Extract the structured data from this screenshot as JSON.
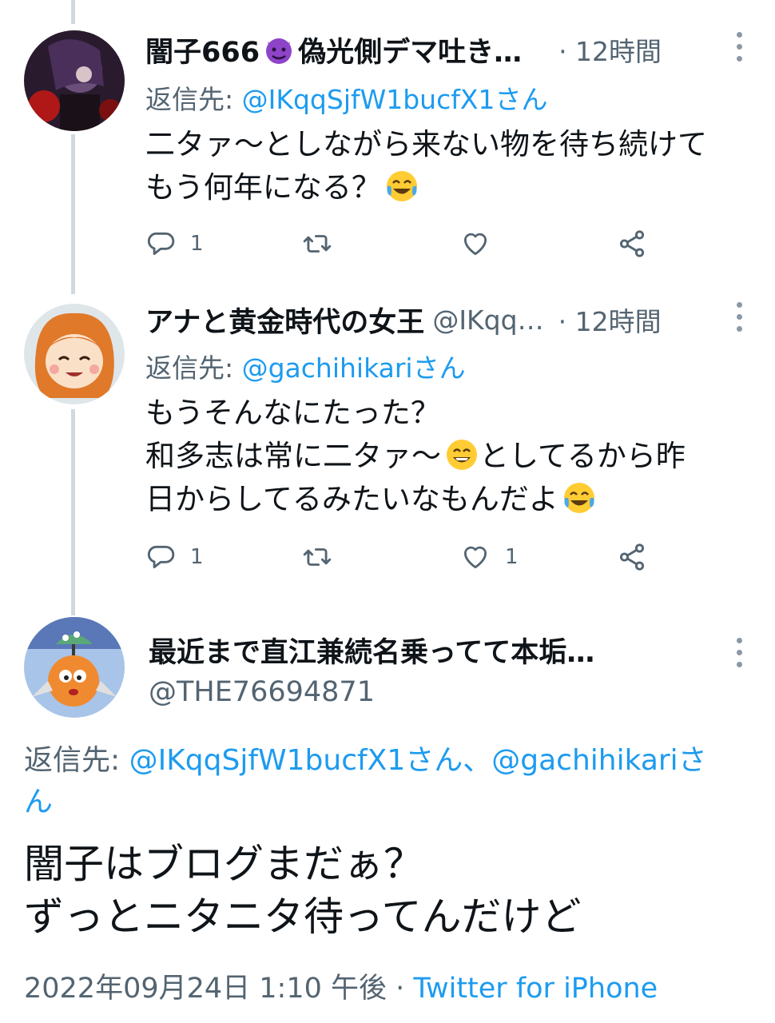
{
  "tweets": [
    {
      "display_name": "闇子666",
      "display_name_emoji": "devil-emoji",
      "display_name_rest": "偽光側デマ吐き…",
      "handle": "",
      "time": "· 12時間",
      "reply_label": "返信先: ",
      "reply_to": "@IKqqSjfW1bucfX1さん",
      "body_lines": [
        "二タァ〜としながら来ない物を待ち続けて",
        "もう何年になる？"
      ],
      "body_end_emoji": "joy-emoji",
      "reply_count": "1",
      "retweet_count": "",
      "like_count": ""
    },
    {
      "display_name": "アナと黄金時代の女王",
      "handle": "@IKqq…",
      "time": "· 12時間",
      "reply_label": "返信先: ",
      "reply_to": "@gachihikariさん",
      "body_lines": [
        "もうそんなにたった？",
        "和多志は常に二タァ〜",
        "としてるから昨",
        "日からしてるみたいなもんだよ"
      ],
      "reply_count": "1",
      "retweet_count": "",
      "like_count": "1"
    }
  ],
  "main_tweet": {
    "display_name": "最近まで直江兼続名乗ってて本垢…",
    "handle": "@THE76694871",
    "reply_label": "返信先: ",
    "reply_to_1": "@IKqqSjfW1bucfX1さん",
    "reply_sep": "、",
    "reply_to_2": "@gachihikariさ",
    "reply_to_2_wrap": "ん",
    "body_lines": [
      "闇子はブログまだぁ？",
      "ずっとニタニタ待ってんだけど"
    ],
    "timestamp": "2022年09月24日 1:10 午後",
    "meta_sep": " · ",
    "source": "Twitter for iPhone"
  },
  "colors": {
    "link": "#1d9bf0",
    "secondary": "#536471",
    "thread_line": "#cfd9de"
  },
  "icons": [
    "reply-icon",
    "retweet-icon",
    "like-icon",
    "share-icon",
    "more-icon"
  ]
}
